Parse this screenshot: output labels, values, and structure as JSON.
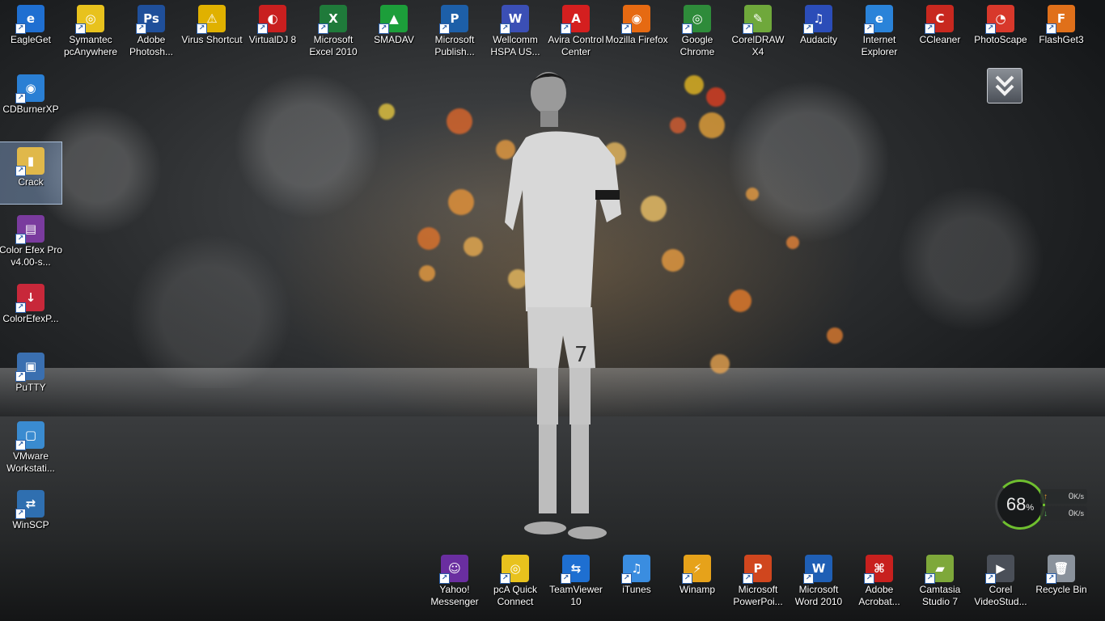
{
  "top_row": [
    {
      "label": "EagleGet",
      "icon": "eagleget-icon",
      "color": "#1f6fd1",
      "glyph": "e"
    },
    {
      "label": "Symantec pcAnywhere",
      "icon": "pcanywhere-icon",
      "color": "#e8c21d",
      "glyph": "◎"
    },
    {
      "label": "Adobe Photosh...",
      "icon": "photoshop-icon",
      "color": "#1f4f9a",
      "glyph": "Ps"
    },
    {
      "label": "Virus Shortcut",
      "icon": "warning-icon",
      "color": "#e0b100",
      "glyph": "⚠"
    },
    {
      "label": "VirtualDJ 8",
      "icon": "virtualdj-icon",
      "color": "#c91f1f",
      "glyph": "◐"
    },
    {
      "label": "Microsoft Excel 2010",
      "icon": "excel-icon",
      "color": "#1f7a3a",
      "glyph": "X"
    },
    {
      "label": "SMADAV",
      "icon": "smadav-icon",
      "color": "#1c9e3a",
      "glyph": "▲"
    },
    {
      "label": "Microsoft Publish...",
      "icon": "publisher-icon",
      "color": "#1d5fa8",
      "glyph": "P"
    },
    {
      "label": "Wellcomm HSPA US...",
      "icon": "wellcomm-icon",
      "color": "#3b4fb5",
      "glyph": "W"
    },
    {
      "label": "Avira Control Center",
      "icon": "avira-icon",
      "color": "#d41f1f",
      "glyph": "A"
    },
    {
      "label": "Mozilla Firefox",
      "icon": "firefox-icon",
      "color": "#e66a12",
      "glyph": "◉"
    },
    {
      "label": "Google Chrome",
      "icon": "chrome-icon",
      "color": "#2e8b3a",
      "glyph": "◎"
    },
    {
      "label": "CorelDRAW X4",
      "icon": "coreldraw-icon",
      "color": "#6fa83b",
      "glyph": "✎"
    },
    {
      "label": "Audacity",
      "icon": "audacity-icon",
      "color": "#2b4db8",
      "glyph": "♫"
    },
    {
      "label": "Internet Explorer",
      "icon": "internet-explorer-icon",
      "color": "#2a83d9",
      "glyph": "e"
    },
    {
      "label": "CCleaner",
      "icon": "ccleaner-icon",
      "color": "#c8281f",
      "glyph": "C"
    },
    {
      "label": "PhotoScape",
      "icon": "photoscape-icon",
      "color": "#d8382b",
      "glyph": "◔"
    },
    {
      "label": "FlashGet3",
      "icon": "flashget-icon",
      "color": "#e0701a",
      "glyph": "F"
    }
  ],
  "left_column": [
    {
      "label": "CDBurnerXP",
      "icon": "cdburnerxp-icon",
      "color": "#2a7fd4",
      "glyph": "◉"
    },
    {
      "label": "Crack",
      "icon": "folder-icon",
      "color": "#e0b84a",
      "glyph": "▮"
    },
    {
      "label": "Color Efex Pro v4.00-s...",
      "icon": "winrar-archive-icon",
      "color": "#7a3b9e",
      "glyph": "▤"
    },
    {
      "label": "ColorEfexP...",
      "icon": "installer-icon",
      "color": "#c8283a",
      "glyph": "↓"
    },
    {
      "label": "PuTTY",
      "icon": "putty-icon",
      "color": "#3a6fb0",
      "glyph": "▣"
    },
    {
      "label": "VMware Workstati...",
      "icon": "vmware-icon",
      "color": "#3a8bd0",
      "glyph": "▢"
    },
    {
      "label": "WinSCP",
      "icon": "winscp-icon",
      "color": "#2f6fb0",
      "glyph": "⇄"
    }
  ],
  "bottom_row": [
    {
      "label": "Yahoo! Messenger",
      "icon": "yahoo-messenger-icon",
      "color": "#6a2ea0",
      "glyph": "☺"
    },
    {
      "label": "pcA Quick Connect",
      "icon": "pca-quick-connect-icon",
      "color": "#e8c21d",
      "glyph": "◎"
    },
    {
      "label": "TeamViewer 10",
      "icon": "teamviewer-icon",
      "color": "#1e6fd1",
      "glyph": "⇆"
    },
    {
      "label": "iTunes",
      "icon": "itunes-icon",
      "color": "#3a8de0",
      "glyph": "♫"
    },
    {
      "label": "Winamp",
      "icon": "winamp-icon",
      "color": "#e6a21a",
      "glyph": "⚡"
    },
    {
      "label": "Microsoft PowerPoi...",
      "icon": "powerpoint-icon",
      "color": "#d0461e",
      "glyph": "P"
    },
    {
      "label": "Microsoft Word 2010",
      "icon": "word-icon",
      "color": "#1f5fb5",
      "glyph": "W"
    },
    {
      "label": "Adobe Acrobat...",
      "icon": "acrobat-icon",
      "color": "#c8201e",
      "glyph": "⌘"
    },
    {
      "label": "Camtasia Studio 7",
      "icon": "camtasia-icon",
      "color": "#7ea83a",
      "glyph": "▰"
    },
    {
      "label": "Corel VideoStud...",
      "icon": "corel-videostudio-icon",
      "color": "#4a4f58",
      "glyph": "▶"
    },
    {
      "label": "Recycle Bin",
      "icon": "recycle-bin-icon",
      "color": "#8a929c",
      "glyph": "🗑"
    }
  ],
  "download_widget": {
    "icon": "chevron-down-double-icon"
  },
  "system_meter": {
    "percent": "68",
    "unit": "%",
    "upload": "0",
    "download": "0",
    "speed_unit": "K/s",
    "ring_color": "#6fbf2f"
  }
}
